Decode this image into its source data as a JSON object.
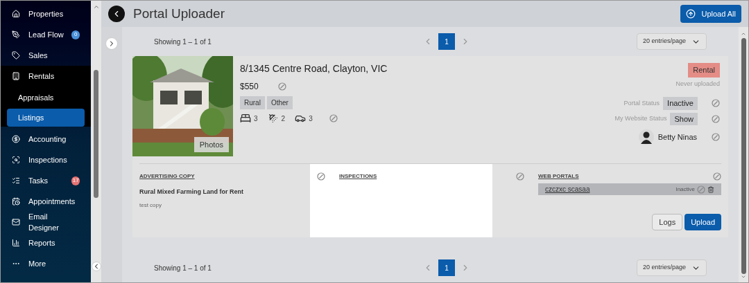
{
  "sidebar": {
    "items": [
      {
        "label": "Properties",
        "selected": false
      },
      {
        "label": "Lead Flow",
        "badge": "0",
        "color": "#4a90d9",
        "selected": false
      },
      {
        "label": "Sales",
        "selected": false
      },
      {
        "label": "Rentals",
        "selected": false,
        "expanded": true,
        "children": [
          {
            "label": "Appraisals",
            "selected": false
          },
          {
            "label": "Listings",
            "selected": true
          }
        ]
      },
      {
        "label": "Accounting",
        "selected": false
      },
      {
        "label": "Inspections",
        "selected": false
      },
      {
        "label": "Tasks",
        "badge": "17",
        "color": "#e57373",
        "selected": false
      },
      {
        "label": "Appointments",
        "selected": false
      },
      {
        "label": "Email Designer",
        "selected": false
      },
      {
        "label": "Reports",
        "selected": false
      },
      {
        "label": "More",
        "selected": false
      }
    ]
  },
  "header": {
    "title": "Portal Uploader",
    "button": "Upload All"
  },
  "pagination_top": {
    "showing": "Showing 1 – 1 of 1",
    "pages": [
      {
        "label": "1",
        "selected": true
      }
    ],
    "per_page": "20 entries/page"
  },
  "listing": {
    "address": "8/1345 Centre Road, Clayton, VIC",
    "price": "$550",
    "tags": [
      "Rural",
      "Other"
    ],
    "beds": "3",
    "baths": "2",
    "cars": "3",
    "photos_button": "Photos",
    "type_badge": "Rental",
    "upload_note": "Never uploaded",
    "statuses": [
      {
        "label": "Portal Status",
        "value": "Inactive"
      },
      {
        "label": "My Website Status",
        "value": "Show"
      }
    ],
    "agent": "Betty Ninas",
    "advertising": {
      "heading": "ADVERTISING COPY",
      "title": "Rural Mixed Farming Land for Rent",
      "body": "test copy"
    },
    "inspections": {
      "heading": "INSPECTIONS"
    },
    "web_portals": {
      "heading": "WEB PORTALS",
      "portals": [
        {
          "name": "czczxc scasaa",
          "status": "Inactive"
        }
      ]
    },
    "buttons": [
      "Logs",
      "Upload"
    ]
  },
  "pagination_bottom": {
    "showing": "Showing 1 – 1 of 1",
    "pages": [
      {
        "label": "1",
        "selected": true
      }
    ],
    "per_page": "20 entries/page"
  }
}
